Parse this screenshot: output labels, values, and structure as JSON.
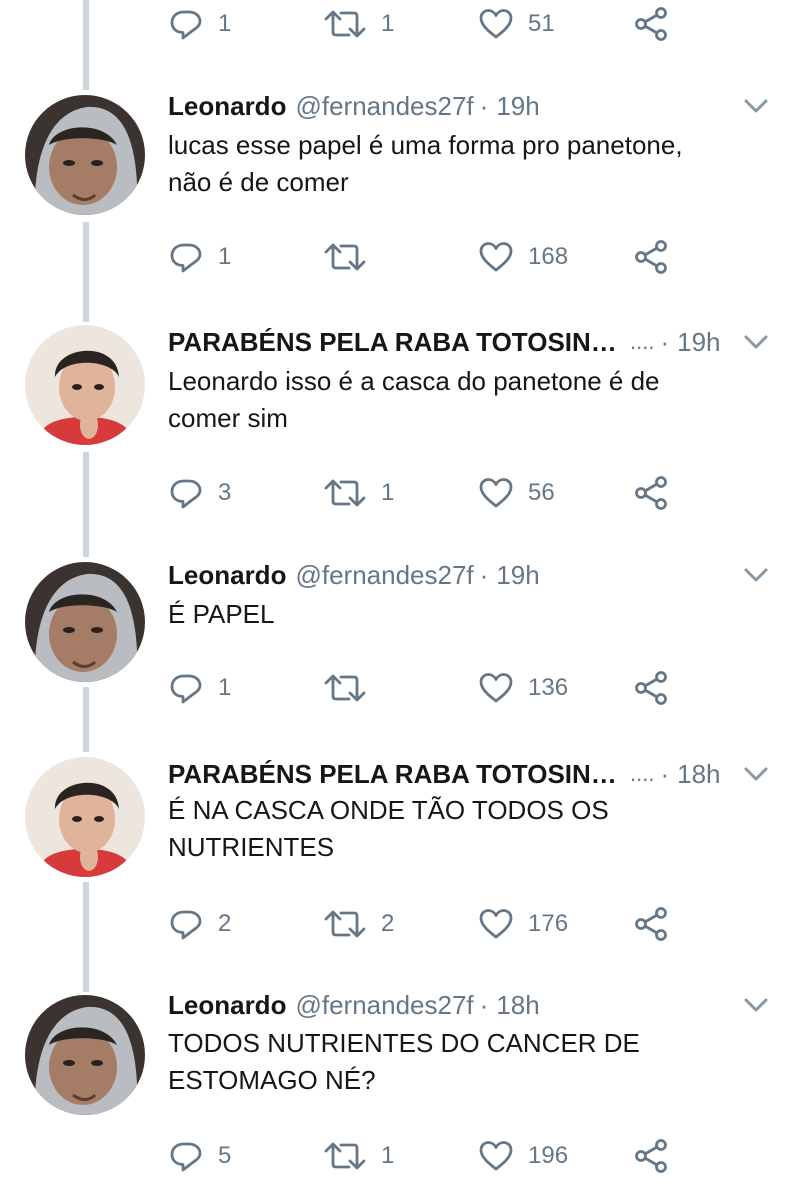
{
  "top_actions": {
    "replies": "1",
    "retweets": "1",
    "likes": "51"
  },
  "tweets": [
    {
      "name": "Leonardo",
      "handle": "@fernandes27f",
      "time": "19h",
      "truncated": false,
      "text_lines": [
        "lucas esse papel é uma forma pro panetone,",
        "não é de comer"
      ],
      "replies": "1",
      "retweets": "",
      "likes": "168"
    },
    {
      "name": "PARABÉNS PELA RABA TOTOSINHA",
      "handle": "",
      "time": "19h",
      "truncated": true,
      "text_lines": [
        "Leonardo isso é a casca do panetone é de",
        "comer sim"
      ],
      "replies": "3",
      "retweets": "1",
      "likes": "56"
    },
    {
      "name": "Leonardo",
      "handle": "@fernandes27f",
      "time": "19h",
      "truncated": false,
      "text_lines": [
        "É PAPEL"
      ],
      "replies": "1",
      "retweets": "",
      "likes": "136"
    },
    {
      "name": "PARABÉNS PELA RABA TOTOSINHA",
      "handle": "",
      "time": "18h",
      "truncated": true,
      "text_lines": [
        "É NA CASCA ONDE TÃO TODOS OS",
        "NUTRIENTES"
      ],
      "replies": "2",
      "retweets": "2",
      "likes": "176"
    },
    {
      "name": "Leonardo",
      "handle": "@fernandes27f",
      "time": "18h",
      "truncated": false,
      "text_lines": [
        "TODOS NUTRIENTES DO CANCER DE",
        "ESTOMAGO NÉ?"
      ],
      "replies": "5",
      "retweets": "1",
      "likes": "196"
    }
  ],
  "ellipsis": "....",
  "separator": "·",
  "icons": {
    "reply": "reply-icon",
    "retweet": "retweet-icon",
    "like": "heart-icon",
    "share": "share-icon",
    "more": "chevron-down-icon"
  },
  "colors": {
    "text": "#14171a",
    "muted": "#657786",
    "icon": "#657786",
    "thread_line": "#ccd6dd"
  }
}
